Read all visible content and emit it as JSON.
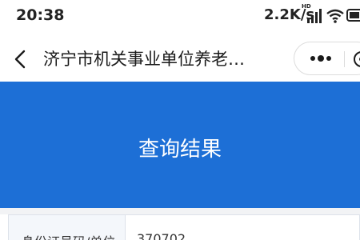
{
  "status_bar": {
    "time": "20:38",
    "network_speed": "2.2K/s",
    "hd_label": "HD",
    "icons": [
      "signal-icon",
      "wifi-icon",
      "battery-icon"
    ]
  },
  "nav_bar": {
    "title": "济宁市机关事业单位养老…",
    "icons": [
      "back-icon",
      "more-icon",
      "close-ring-icon"
    ]
  },
  "banner": {
    "title": "查询结果",
    "color": "#1d6fd6"
  },
  "table": {
    "rows": [
      {
        "label": "身份证号码/单位",
        "value": "370702"
      }
    ]
  }
}
